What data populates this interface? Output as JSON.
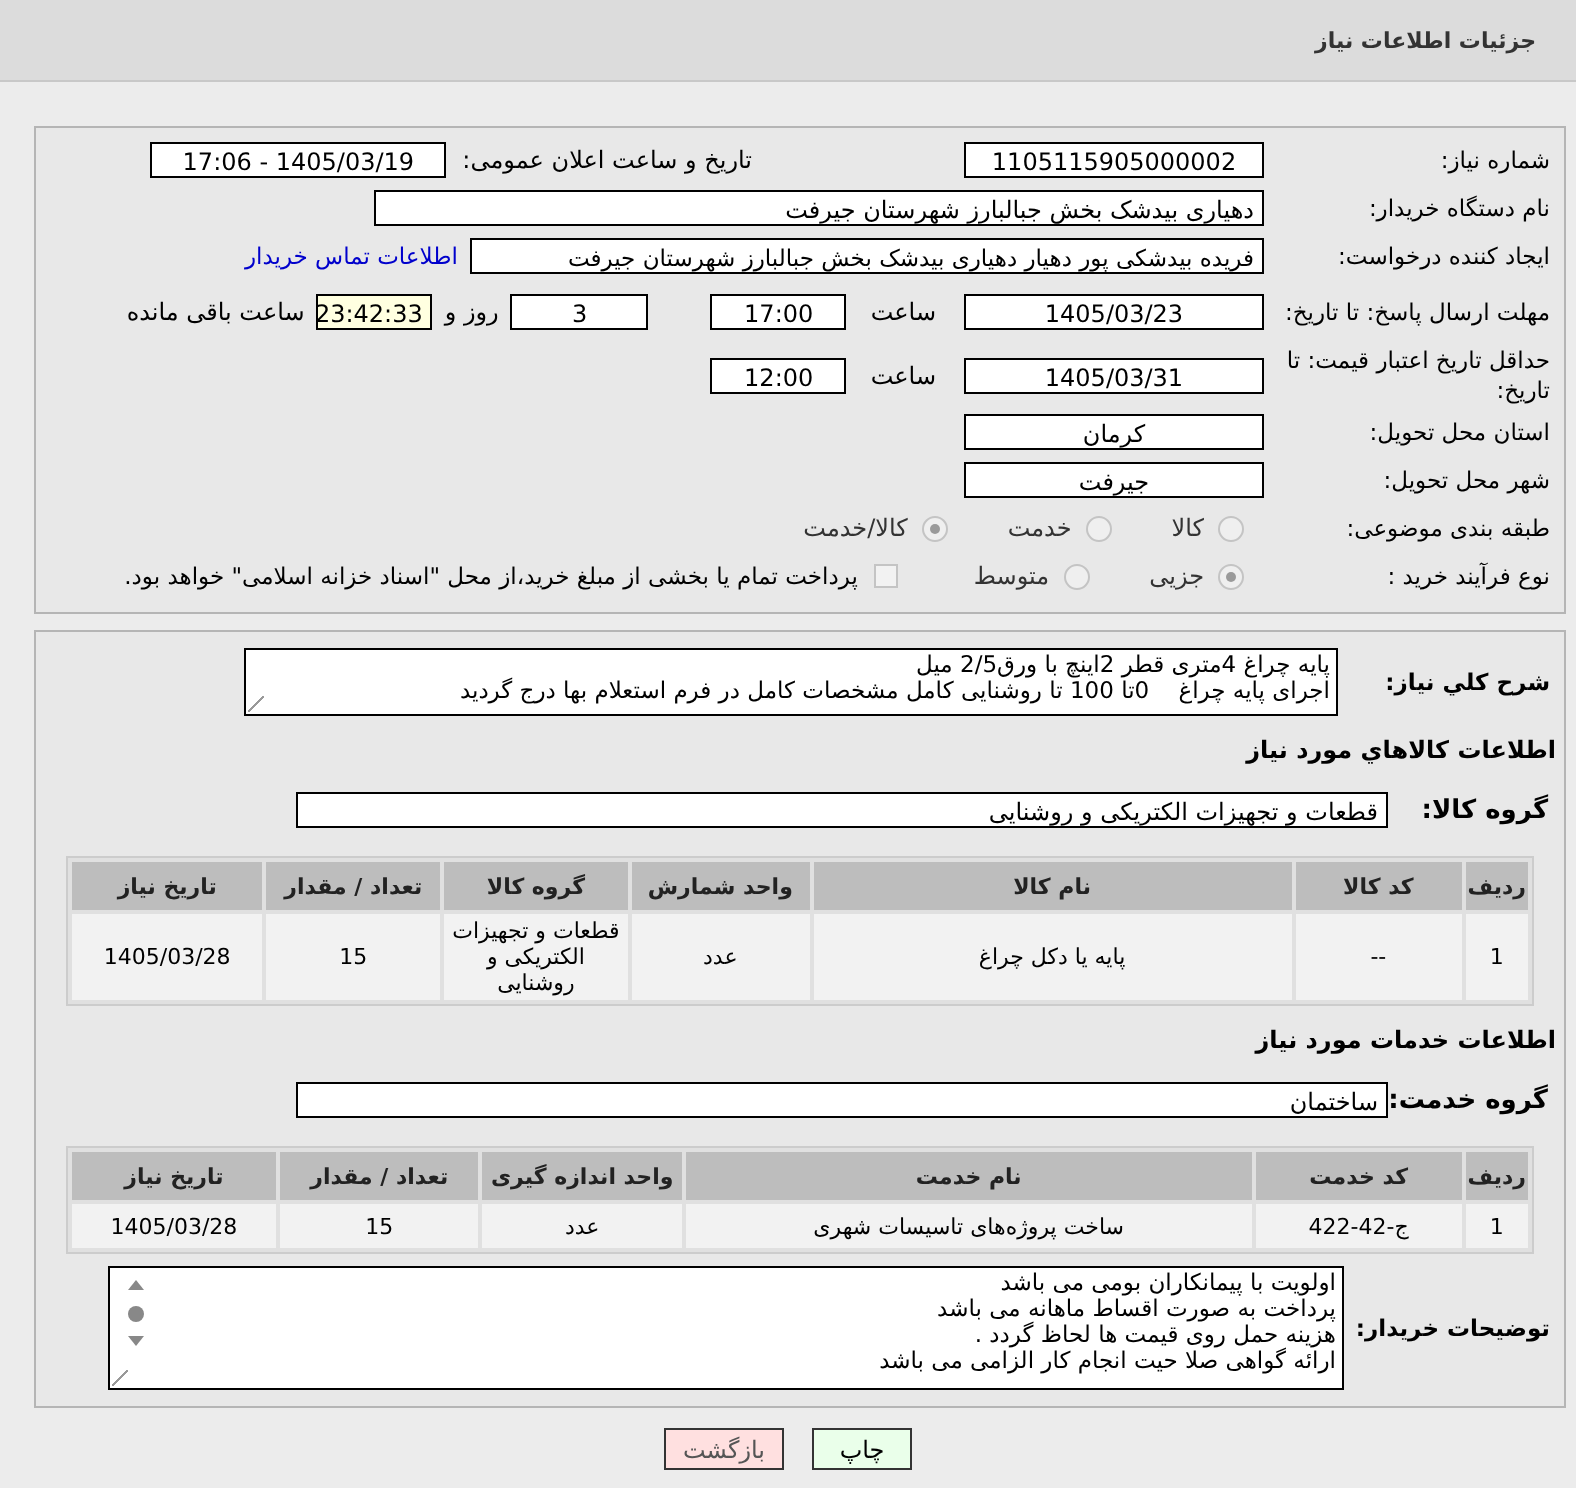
{
  "header": {
    "title": "جزئیات اطلاعات نیاز"
  },
  "need_info": {
    "need_number": {
      "label": "شماره نیاز:",
      "value": "1105115905000002"
    },
    "announce": {
      "label": "تاریخ و ساعت اعلان عمومی:",
      "value": "1405/03/19 - 17:06"
    },
    "buyer": {
      "label": "نام دستگاه خریدار:",
      "value": "دهیاری بیدشک بخش جبالبارز شهرستان جیرفت"
    },
    "creator": {
      "label": "ایجاد کننده درخواست:",
      "value": "فریده بیدشکی پور  دهیار  دهیاری بیدشک بخش جبالبارز شهرستان جیرفت",
      "link": "اطلاعات تماس خریدار"
    },
    "deadline": {
      "label": "مهلت ارسال پاسخ: تا تاریخ:",
      "date": "1405/03/23",
      "time_label": "ساعت",
      "time": "17:00",
      "days": "3",
      "days_label": "روز و",
      "remaining": "23:42:33",
      "remaining_label": "ساعت باقی مانده"
    },
    "validity": {
      "label": "حداقل تاریخ اعتبار قیمت: تا تاریخ:",
      "date": "1405/03/31",
      "time_label": "ساعت",
      "time": "12:00"
    },
    "province": {
      "label": "استان محل تحویل:",
      "value": "کرمان"
    },
    "city": {
      "label": "شهر محل تحویل:",
      "value": "جیرفت"
    },
    "category": {
      "label": "طبقه بندی موضوعی:",
      "options": [
        {
          "label": "کالا",
          "selected": false
        },
        {
          "label": "خدمت",
          "selected": false
        },
        {
          "label": "کالا/خدمت",
          "selected": true
        }
      ]
    },
    "purchase_type": {
      "label": "نوع فرآیند خرید :",
      "options": [
        {
          "label": "جزیی",
          "selected": true
        },
        {
          "label": "متوسط",
          "selected": false
        }
      ],
      "payment": {
        "label": "پرداخت تمام یا بخشی از مبلغ خرید،از محل \"اسناد خزانه اسلامی\" خواهد بود.",
        "checked": false
      }
    }
  },
  "description": {
    "label": "شرح کلي نياز:",
    "lines": [
      "پایه چراغ 4متری قطر 2اینچ با ورق2/5 میل",
      "اجرای پایه چراغ    0تا 100 تا روشنایی کامل مشخصات کامل در فرم استعلام بها درج گردید"
    ]
  },
  "goods": {
    "title": "اطلاعات کالاهاي مورد نياز",
    "group_label": "گروه کالا:",
    "group_value": "قطعات و تجهیزات الکتریکی و روشنایی",
    "columns": [
      "ردیف",
      "کد کالا",
      "نام کالا",
      "واحد شمارش",
      "گروه کالا",
      "تعداد / مقدار",
      "تاریخ نیاز"
    ],
    "rows": [
      [
        "1",
        "--",
        "پایه یا دکل چراغ",
        "عدد",
        "قطعات و تجهیزات الکتریکی و روشنایی",
        "15",
        "1405/03/28"
      ]
    ]
  },
  "services": {
    "title": "اطلاعات خدمات مورد نیاز",
    "group_label": "گروه خدمت:",
    "group_value": "ساختمان",
    "columns": [
      "ردیف",
      "کد خدمت",
      "نام خدمت",
      "واحد اندازه گیری",
      "تعداد / مقدار",
      "تاریخ نیاز"
    ],
    "rows": [
      [
        "1",
        "ج-42-422",
        "ساخت پروژه‌های تاسیسات شهری",
        "عدد",
        "15",
        "1405/03/28"
      ]
    ]
  },
  "buyer_notes": {
    "label": "توضیحات خریدار:",
    "lines": [
      "اولویت با پیمانکاران بومی می باشد",
      "پرداخت به صورت اقساط ماهانه می باشد",
      "هزینه حمل روی قیمت ها لحاظ گردد .",
      "ارائه گواهی صلا حیت انجام کار الزامی می باشد"
    ]
  },
  "buttons": [
    {
      "label": "چاپ",
      "kind": "print"
    },
    {
      "label": "بازگشت",
      "kind": "back"
    }
  ]
}
